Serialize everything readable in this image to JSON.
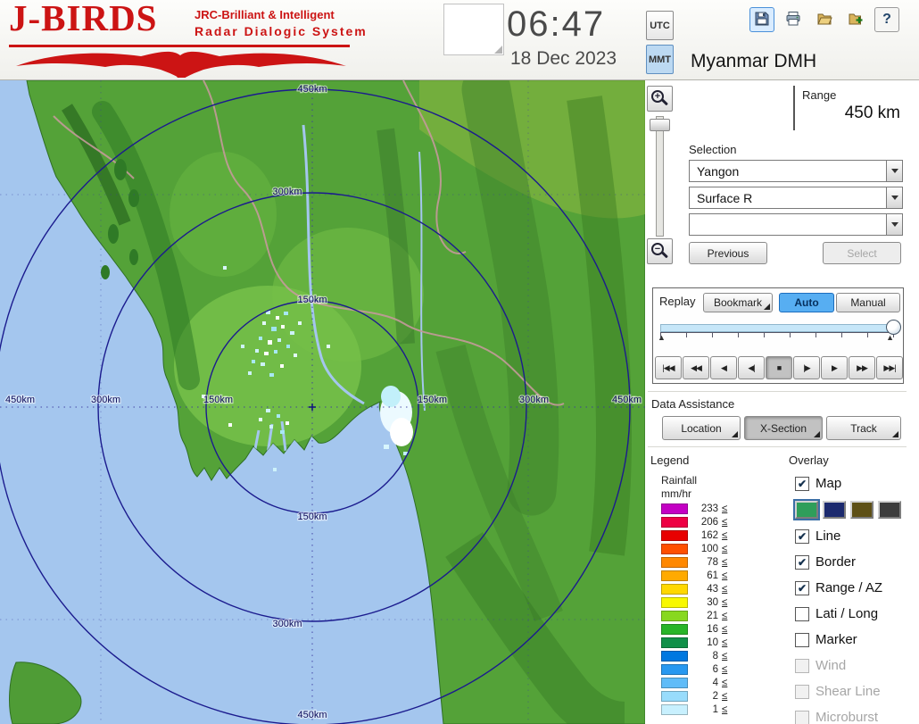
{
  "header": {
    "logo": {
      "title": "J-BIRDS",
      "tagline_line1": "JRC-Brilliant & Intelligent",
      "tagline_line2": "Radar  Dialogic  System"
    },
    "clock": {
      "time": "06:47",
      "date": "18 Dec 2023"
    },
    "timezone": {
      "utc": "UTC",
      "mmt": "MMT"
    },
    "toolbar": {
      "help_glyph": "?"
    },
    "station_title": "Myanmar DMH"
  },
  "range": {
    "label": "Range",
    "value": "450 km"
  },
  "selection": {
    "label": "Selection",
    "site": "Yangon",
    "product": "Surface R",
    "extra": ""
  },
  "nav": {
    "previous": "Previous",
    "select": "Select"
  },
  "replay": {
    "label": "Replay",
    "bookmark": "Bookmark",
    "auto": "Auto",
    "manual": "Manual",
    "markers": {
      "start": "▲",
      "end": "▲"
    },
    "transport": [
      "|◀◀",
      "◀◀",
      "◀",
      "◀|",
      "■",
      "|▶",
      "▶",
      "▶▶",
      "▶▶|"
    ]
  },
  "data_assistance": {
    "label": "Data Assistance",
    "location": "Location",
    "xsection": "X-Section",
    "track": "Track"
  },
  "legend": {
    "title": "Legend",
    "unit_line1": "Rainfall",
    "unit_line2": "mm/hr",
    "suffix": "≤",
    "entries": [
      {
        "value": "233",
        "color": "#c400c4"
      },
      {
        "value": "206",
        "color": "#ee0044"
      },
      {
        "value": "162",
        "color": "#e80000"
      },
      {
        "value": "100",
        "color": "#ff5000"
      },
      {
        "value": "78",
        "color": "#ff8800"
      },
      {
        "value": "61",
        "color": "#ffaa00"
      },
      {
        "value": "43",
        "color": "#ffd800"
      },
      {
        "value": "30",
        "color": "#f8f800"
      },
      {
        "value": "21",
        "color": "#88d820"
      },
      {
        "value": "16",
        "color": "#28b428"
      },
      {
        "value": "10",
        "color": "#109048"
      },
      {
        "value": "8",
        "color": "#0078e0"
      },
      {
        "value": "6",
        "color": "#2898f0"
      },
      {
        "value": "4",
        "color": "#60bcf8"
      },
      {
        "value": "2",
        "color": "#98dcfc"
      },
      {
        "value": "1",
        "color": "#c8f0fe"
      }
    ]
  },
  "overlay": {
    "title": "Overlay",
    "items": [
      {
        "label": "Map",
        "check": "✔"
      },
      {
        "label": "Line",
        "check": "✔"
      },
      {
        "label": "Border",
        "check": "✔"
      },
      {
        "label": "Range / AZ",
        "check": "✔"
      },
      {
        "label": "Lati / Long",
        "check": ""
      },
      {
        "label": "Marker",
        "check": ""
      },
      {
        "label": "Wind",
        "check": ""
      },
      {
        "label": "Shear Line",
        "check": ""
      },
      {
        "label": "Microburst",
        "check": ""
      }
    ],
    "map_palette": [
      "#2f9e5a",
      "#1c2a6e",
      "#5e5016",
      "#3c3c3c"
    ]
  },
  "map": {
    "zoom_in": "+",
    "zoom_out": "−",
    "ring_labels": {
      "r150": "150km",
      "r300": "300km",
      "r450": "450km"
    }
  }
}
